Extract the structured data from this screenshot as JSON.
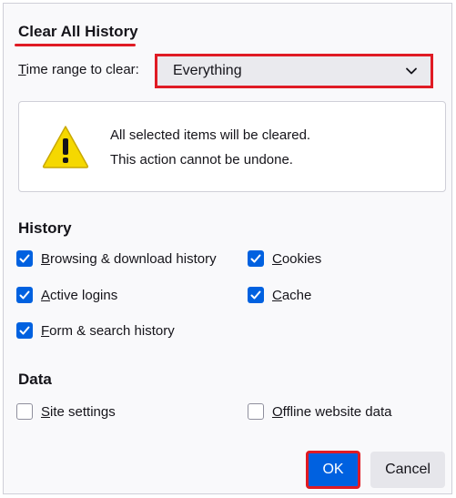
{
  "dialog": {
    "title": "Clear All History",
    "time_range": {
      "label_first": "T",
      "label_rest": "ime range to clear:",
      "selected": "Everything"
    },
    "alert": {
      "line1": "All selected items will be cleared.",
      "line2": "This action cannot be undone.",
      "icon": "warning-icon"
    },
    "history": {
      "heading": "History",
      "items": [
        {
          "access": "B",
          "rest": "rowsing & download history",
          "checked": true
        },
        {
          "access": "C",
          "rest": "ookies",
          "checked": true
        },
        {
          "access": "A",
          "rest": "ctive logins",
          "checked": true
        },
        {
          "access": "C",
          "rest": "ache",
          "checked": true
        },
        {
          "access": "F",
          "rest": "orm & search history",
          "checked": true
        }
      ]
    },
    "data": {
      "heading": "Data",
      "items": [
        {
          "access": "S",
          "rest": "ite settings",
          "checked": false
        },
        {
          "access": "O",
          "rest": "ffline website data",
          "checked": false
        }
      ]
    },
    "buttons": {
      "ok": "OK",
      "cancel": "Cancel"
    },
    "colors": {
      "accent": "#0061e0",
      "highlight": "#e01b24",
      "warning": "#f5d800"
    }
  }
}
